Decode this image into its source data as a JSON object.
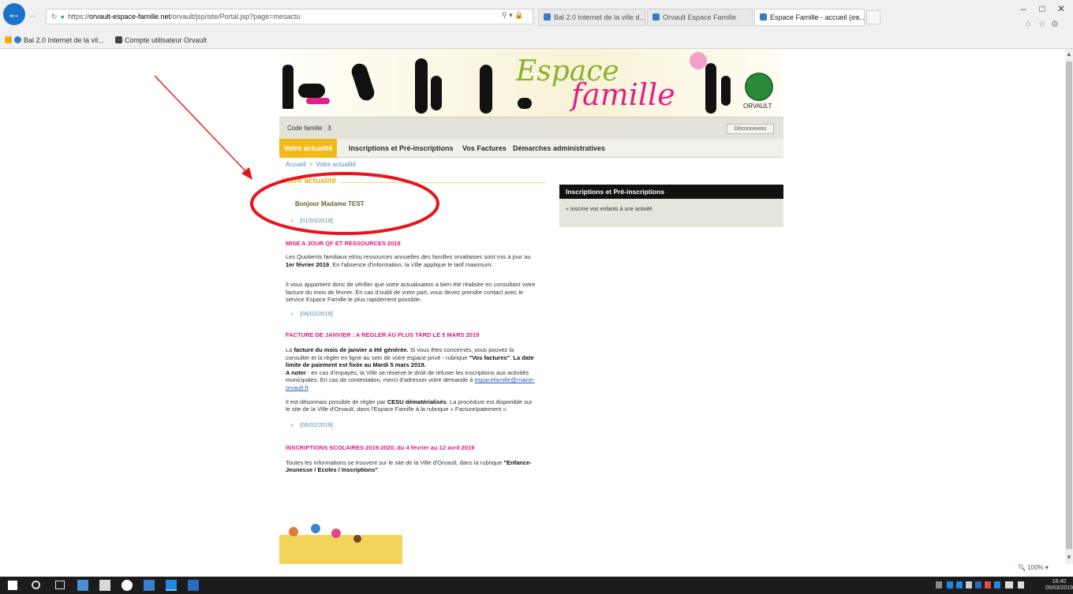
{
  "browser": {
    "url": {
      "prefix": "https://",
      "host": "orvault-espace-famille.net",
      "path": "/orvault/jsp/site/Portal.jsp?page=mesactu"
    },
    "tabs": [
      {
        "label": "Bal 2.0 Internet de la ville d..."
      },
      {
        "label": "Orvault Espace Famille"
      },
      {
        "label": "Espace Famille - accueil (es..."
      }
    ],
    "favorites": [
      {
        "label": "Bal 2.0 Internet de la vil..."
      },
      {
        "label": "Compte utilisateur Orvault"
      }
    ],
    "zoom": "100%"
  },
  "site": {
    "banner_title_1": "Espace",
    "banner_title_2": "famille",
    "logo_text": "ORVAULT",
    "user_code_label": "Code famille : 3",
    "logout_label": "Déconnexion",
    "menu": [
      {
        "label": "Votre actualité"
      },
      {
        "label": "Inscriptions et Pré-inscriptions"
      },
      {
        "label": "Vos Factures"
      },
      {
        "label": "Démarches administratives"
      }
    ],
    "breadcrumb": {
      "home": "Accueil",
      "current": "Votre actualité"
    },
    "section_title": "Votre actualité",
    "greeting": "Bonjour Madame TEST",
    "sidebox": {
      "title": "Inscriptions et Pré-inscriptions",
      "link": "» Inscrire vos enfants à une activité"
    },
    "news": {
      "date1": "[01/03/2019]",
      "n1_title": "MISE A JOUR QF ET RESSOURCES 2019",
      "n1_p1_a": "Les Quotients familiaux et/ou ressources annuelles des familles orvaltaises sont mis à jour au ",
      "n1_p1_b": "1er février 2019",
      "n1_p1_c": ". En l'absence d'information, la Ville applique le tarif maximum.",
      "n1_p2": "Il vous appartient donc de vérifier que votre actualisation a bien été réalisée en consultant votre facture du mois de février. En cas d'oubli de votre part, vous devez prendre contact avec le service Espace Famille le plus rapidement possible.",
      "date2": "[06/02/2019]",
      "n2_title": "FACTURE DE JANVIER : A REGLER AU PLUS TARD LE 5 MARS 2019",
      "n2_p1_a": "La ",
      "n2_p1_b": "facture du mois de janvier a été générée.",
      "n2_p1_c": " Si vous êtes concernés, vous pouvez la consulter et la régler en ligne au sein de votre espace privé - rubrique ",
      "n2_p1_d": "\"Vos factures\"",
      "n2_p1_e": ". ",
      "n2_p1_f": "La date limite de paiement est fixée au Mardi 5 mars 2019.",
      "n2_p2_a": "A noter",
      "n2_p2_b": " : en cas d'impayés, la Ville se réserve le droit de refuser les inscriptions aux activités municipales. En cas de contestation, merci d'adresser votre demande à ",
      "n2_p2_c": "espacefamille@mairie-orvault.fr",
      "n2_p2_d": ".",
      "n2_p3_a": "Il est désormais possible de régler par ",
      "n2_p3_b": "CESU dématérialisés",
      "n2_p3_c": ". La procédure est disponible sur le site de la Ville d'Orvault, dans l'Espace Famille à la rubrique « Facture/paiement ».",
      "date3": "[06/02/2019]",
      "n3_title": "INSCRIPTIONS SCOLAIRES 2019-2020, du 4 février au 12 avril 2019",
      "n3_p1_a": "Toutes les informations se trouvent sur le site de la Ville d'Orvault, dans la rubrique ",
      "n3_p1_b": "\"Enfance-Jeunesse / Ecoles / Inscriptions\"",
      "n3_p1_c": "."
    }
  },
  "taskbar": {
    "time": "16:40",
    "date": "05/03/2019"
  },
  "colors": {
    "accent": "#f2b91a",
    "news_title": "#e0168c",
    "annotation": "#e8141c"
  }
}
